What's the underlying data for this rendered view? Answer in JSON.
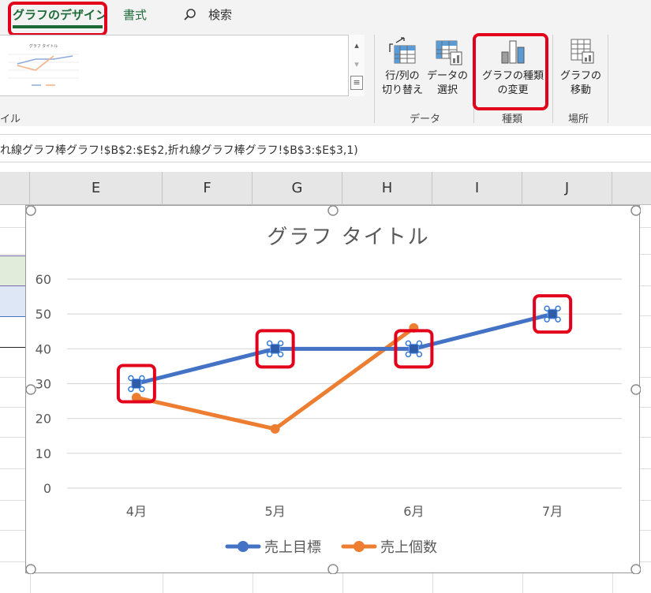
{
  "ribbon": {
    "tabs": [
      {
        "label": "グラフのデザイン"
      },
      {
        "label": "書式"
      },
      {
        "label": "検索"
      }
    ],
    "style_group_label": "イル",
    "buttons": {
      "switch_row_col": {
        "line1": "行/列の",
        "line2": "切り替え"
      },
      "select_data": {
        "line1": "データの",
        "line2": "選択"
      },
      "change_type": {
        "line1": "グラフの種類",
        "line2": "の変更"
      },
      "move_chart": {
        "line1": "グラフの",
        "line2": "移動"
      }
    },
    "groups": {
      "data": "データ",
      "type": "種類",
      "location": "場所"
    },
    "thumbnail_title": "グラフ タイトル"
  },
  "formula": {
    "text": "れ線グラフ棒グラフ!$B$2:$E$2,折れ線グラフ棒グラフ!$B$3:$E$3,1)"
  },
  "columns": [
    "E",
    "F",
    "G",
    "H",
    "I",
    "J"
  ],
  "chart_data": {
    "type": "line",
    "title": "グラフ タイトル",
    "categories": [
      "4月",
      "5月",
      "6月",
      "7月"
    ],
    "ylim": [
      0,
      60
    ],
    "yticks": [
      0,
      10,
      20,
      30,
      40,
      50,
      60
    ],
    "grid": true,
    "legend_position": "bottom",
    "series": [
      {
        "name": "売上目標",
        "values": [
          30,
          40,
          40,
          50
        ],
        "color": "#4472c4"
      },
      {
        "name": "売上個数",
        "values": [
          26,
          17,
          46,
          null
        ],
        "color": "#ed7d31"
      }
    ]
  }
}
